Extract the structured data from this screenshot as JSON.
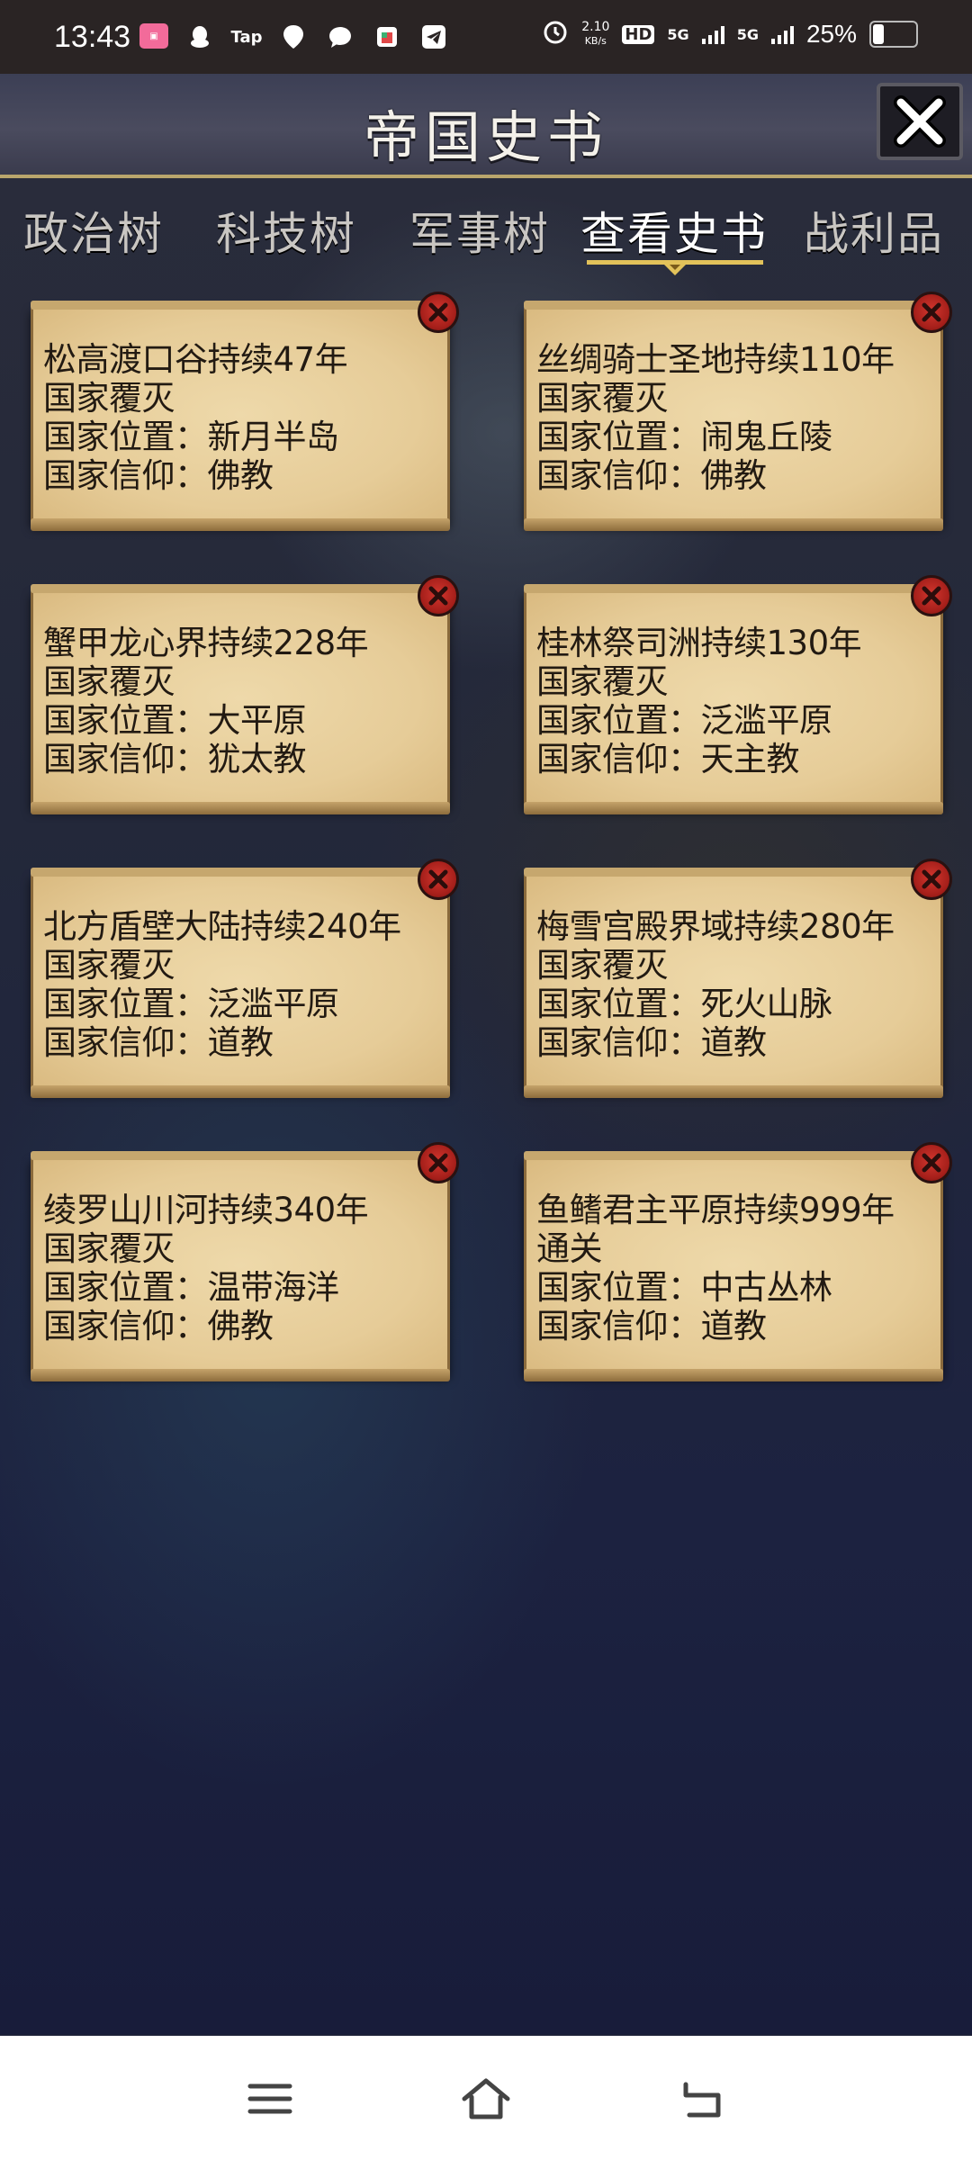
{
  "status_bar": {
    "time": "13:43",
    "app_icons": [
      "bilibili-icon",
      "qq-icon",
      "tap-icon",
      "du-icon",
      "chat-icon",
      "store-icon",
      "telegram-icon"
    ],
    "tap_label": "Tap",
    "du_label": "du",
    "net_speed_value": "2.10",
    "net_speed_unit": "KB/s",
    "hd_label": "HD",
    "sim1_label": "5G",
    "sim2_label": "5G",
    "battery_percent": "25%"
  },
  "header": {
    "title": "帝国史书"
  },
  "tabs": [
    {
      "label": "政治树",
      "active": false
    },
    {
      "label": "科技树",
      "active": false
    },
    {
      "label": "军事树",
      "active": false
    },
    {
      "label": "查看史书",
      "active": true
    },
    {
      "label": "战利品",
      "active": false
    }
  ],
  "records": [
    {
      "line1": "松高渡口谷持续47年",
      "line2": "国家覆灭",
      "line3": "国家位置：新月半岛",
      "line4": "国家信仰：佛教"
    },
    {
      "line1": "丝绸骑士圣地持续110年",
      "line2": "国家覆灭",
      "line3": "国家位置：闹鬼丘陵",
      "line4": "国家信仰：佛教"
    },
    {
      "line1": "蟹甲龙心界持续228年",
      "line2": "国家覆灭",
      "line3": "国家位置：大平原",
      "line4": "国家信仰：犹太教"
    },
    {
      "line1": "桂林祭司洲持续130年",
      "line2": "国家覆灭",
      "line3": "国家位置：泛滥平原",
      "line4": "国家信仰：天主教"
    },
    {
      "line1": "北方盾壁大陆持续240年",
      "line2": "国家覆灭",
      "line3": "国家位置：泛滥平原",
      "line4": "国家信仰：道教"
    },
    {
      "line1": "梅雪宫殿界域持续280年",
      "line2": "国家覆灭",
      "line3": "国家位置：死火山脉",
      "line4": "国家信仰：道教"
    },
    {
      "line1": "绫罗山川河持续340年",
      "line2": "国家覆灭",
      "line3": "国家位置：温带海洋",
      "line4": "国家信仰：佛教"
    },
    {
      "line1": "鱼鳍君主平原持续999年",
      "line2": "通关",
      "line3": "国家位置：中古丛林",
      "line4": "国家信仰：道教"
    }
  ],
  "colors": {
    "card_parchment": "#e6cc98",
    "card_text": "#221a12",
    "close_red": "#c22a23",
    "tab_underline_gold": "#e2c25a"
  }
}
